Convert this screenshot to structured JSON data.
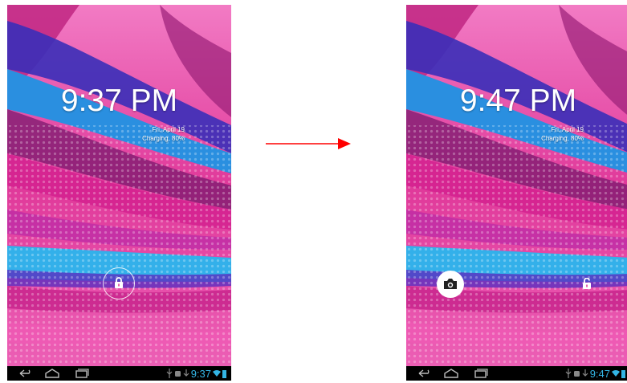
{
  "before": {
    "clock": "9:37 PM",
    "date": "Fri, April 19",
    "charging": "Charging, 80%",
    "status_time": "9:37"
  },
  "after": {
    "clock": "9:47 PM",
    "date": "Fri, April 19",
    "charging": "Charging, 80%",
    "status_time": "9:47"
  },
  "icons": {
    "unlock_ring": "lock-icon",
    "camera": "camera-icon",
    "unlock_target": "unlock-icon",
    "nav_back": "back-icon",
    "nav_home": "home-icon",
    "nav_recent": "recent-apps-icon",
    "transition": "right-arrow-icon"
  },
  "colors": {
    "arrow": "#ff0000",
    "status_time": "#33b5e5",
    "wallpaper_pink": "#e0399a",
    "wallpaper_blue": "#2a8fe0"
  }
}
